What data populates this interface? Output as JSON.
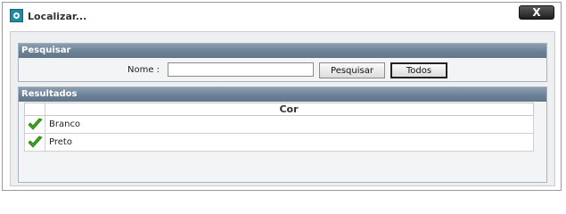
{
  "window": {
    "title": "Localizar...",
    "close_label": "X"
  },
  "search": {
    "section_title": "Pesquisar",
    "nome_label": "Nome :",
    "nome_value": "",
    "pesquisar_label": "Pesquisar",
    "todos_label": "Todos"
  },
  "results": {
    "section_title": "Resultados",
    "column_header": "Cor",
    "rows": [
      {
        "value": "Branco"
      },
      {
        "value": "Preto"
      }
    ]
  },
  "colors": {
    "accent": "#6c8196",
    "check": "#3aa51e"
  }
}
